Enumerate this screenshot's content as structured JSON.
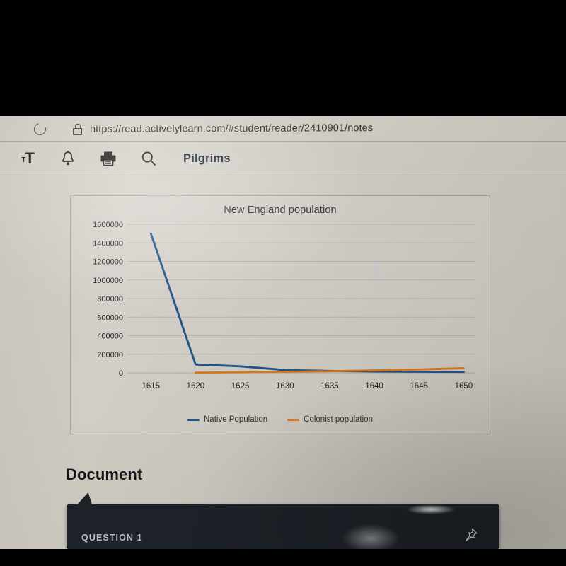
{
  "browser": {
    "url": "https://read.activelylearn.com/#student/reader/2410901/notes",
    "reload_icon": "reload-icon",
    "lock_icon": "lock-icon"
  },
  "toolbar": {
    "text_size_small": "т",
    "text_size_large": "T",
    "icons": [
      "text-size-icon",
      "bell-icon",
      "printer-icon",
      "search-icon"
    ],
    "document_title": "Pilgrims"
  },
  "document_section": {
    "heading": "Document"
  },
  "question_panel": {
    "label": "QUESTION 1",
    "pin_icon": "pushpin-icon"
  },
  "chart_data": {
    "type": "line",
    "title": "New England population",
    "xlabel": "",
    "ylabel": "",
    "x": [
      1615,
      1620,
      1625,
      1630,
      1635,
      1640,
      1645,
      1650
    ],
    "xticks": [
      "1615",
      "1620",
      "1625",
      "1630",
      "1635",
      "1640",
      "1645",
      "1650"
    ],
    "yticks": [
      "0",
      "200000",
      "400000",
      "600000",
      "800000",
      "1000000",
      "1200000",
      "1400000",
      "1600000"
    ],
    "ytick_values": [
      0,
      200000,
      400000,
      600000,
      800000,
      1000000,
      1200000,
      1400000,
      1600000
    ],
    "xlim": [
      1613,
      1651
    ],
    "ylim": [
      0,
      1600000
    ],
    "grid": true,
    "legend_position": "bottom",
    "series": [
      {
        "name": "Native Population",
        "color": "#23528c",
        "values": [
          1500000,
          90000,
          70000,
          30000,
          20000,
          15000,
          12000,
          10000
        ]
      },
      {
        "name": "Colonist population",
        "color": "#d87b23",
        "values": [
          null,
          2000,
          6000,
          12000,
          18000,
          26000,
          36000,
          50000
        ]
      }
    ]
  }
}
